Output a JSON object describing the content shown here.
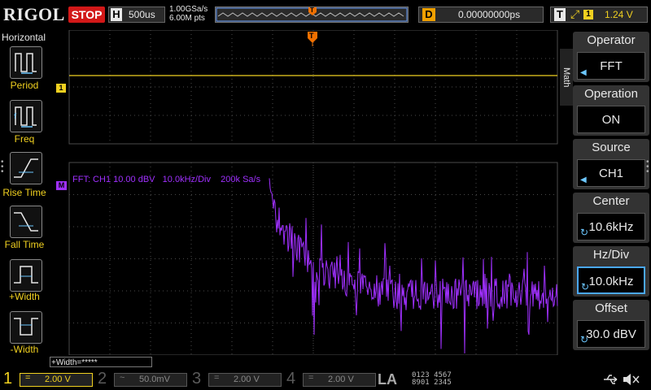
{
  "top_bar": {
    "logo": "RIGOL",
    "run_state": "STOP",
    "timebase_label": "H",
    "timebase_value": "500us",
    "sample_rate": "1.00GSa/s",
    "memory_depth": "6.00M pts",
    "trigger_marker": "T",
    "delay_label": "D",
    "delay_value": "0.00000000ps",
    "trigger_label": "T",
    "trigger_edge": "⤢",
    "trigger_channel": "1",
    "trigger_level": "1.24 V"
  },
  "left_panel": {
    "title": "Horizontal",
    "items": [
      {
        "label": "Period"
      },
      {
        "label": "Freq"
      },
      {
        "label": "Rise Time"
      },
      {
        "label": "Fall Time"
      },
      {
        "label": "+Width"
      },
      {
        "label": "-Width"
      }
    ]
  },
  "screen": {
    "ch1_marker": "1",
    "math_marker": "M",
    "trigger_pos_marker": "T",
    "fft_info": "FFT: CH1 10.00 dBV   10.0kHz/Div    200k Sa/s",
    "colors": {
      "ch1": "#f0d020",
      "math": "#a030ff",
      "grid": "#4a4a4a",
      "trigger": "#f07000"
    }
  },
  "right_panel": {
    "math_tab": "Math",
    "blocks": [
      {
        "title": "Operator",
        "value": "FFT",
        "control": "arrow"
      },
      {
        "title": "Operation",
        "value": "ON",
        "control": "none"
      },
      {
        "title": "Source",
        "value": "CH1",
        "control": "arrow"
      },
      {
        "title": "Center",
        "value": "10.6kHz",
        "control": "knob"
      },
      {
        "title": "Hz/Div",
        "value": "10.0kHz",
        "control": "knob-active"
      },
      {
        "title": "Offset",
        "value": "30.0 dBV",
        "control": "knob"
      }
    ]
  },
  "bottom_bar": {
    "measure_box": "+Width=*****",
    "channels": [
      {
        "num": "1",
        "coupling": "=",
        "scale": "2.00 V",
        "color": "#f0d020"
      },
      {
        "num": "2",
        "coupling": "~",
        "scale": "50.0mV",
        "color": "#5a5a5a"
      },
      {
        "num": "3",
        "coupling": "=",
        "scale": "2.00 V",
        "color": "#5a5a5a"
      },
      {
        "num": "4",
        "coupling": "=",
        "scale": "2.00 V",
        "color": "#5a5a5a"
      }
    ],
    "la_label": "LA",
    "la_row1": "0123 4567",
    "la_row2": "8901 2345"
  }
}
